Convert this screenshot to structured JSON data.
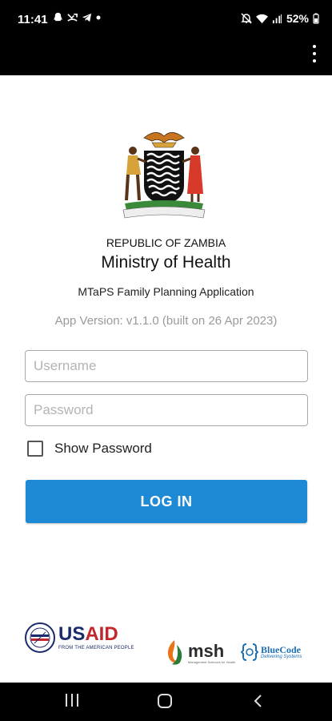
{
  "status_bar": {
    "time": "11:41",
    "battery": "52%",
    "left_icons": [
      "snapchat-icon",
      "missed-call-icon",
      "telegram-icon",
      "dot-icon"
    ],
    "right_icons": [
      "mute-icon",
      "wifi-icon",
      "signal-icon"
    ]
  },
  "app_bar": {
    "menu_icon": "overflow-menu-icon"
  },
  "header": {
    "emblem": "zambia-coat-of-arms",
    "republic": "REPUBLIC OF ZAMBIA",
    "ministry": "Ministry of Health",
    "app_name": "MTaPS Family Planning Application",
    "version": "App Version: v1.1.0 (built on 26 Apr 2023)"
  },
  "form": {
    "username_placeholder": "Username",
    "username_value": "",
    "password_placeholder": "Password",
    "password_value": "",
    "show_password_label": "Show Password",
    "show_password_checked": false,
    "login_label": "LOG IN"
  },
  "logos": {
    "usaid": {
      "us": "US",
      "aid": "AID",
      "tagline": "FROM THE AMERICAN PEOPLE"
    },
    "msh": {
      "name": "msh",
      "tagline": "Management Sciences for Health"
    },
    "bluecode": {
      "name": "BlueCode",
      "tagline": "Delivering Systems"
    }
  },
  "colors": {
    "primary_button": "#1e8ad6",
    "usaid_blue": "#1a2a6c",
    "usaid_red": "#c1272d",
    "bluecode_blue": "#1c6fb3"
  },
  "nav_bar": {
    "icons": [
      "recents-icon",
      "home-icon",
      "back-icon"
    ]
  }
}
